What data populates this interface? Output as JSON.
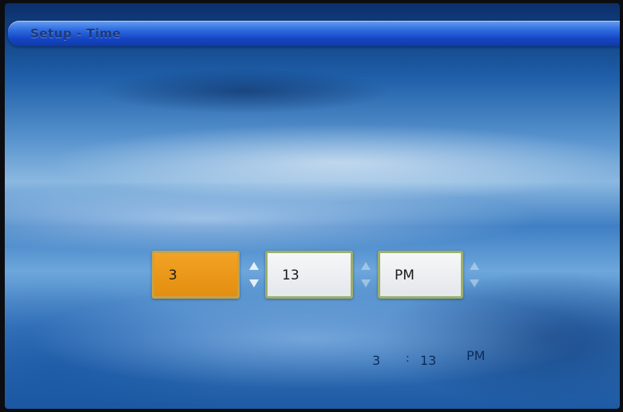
{
  "header": {
    "title": "Setup - Time"
  },
  "time_fields": {
    "hour": "3",
    "minute": "13",
    "meridiem": "PM"
  },
  "readout": {
    "hour": "3",
    "separator": ":",
    "minute": "13",
    "meridiem": "PM"
  },
  "colors": {
    "selected_field": "#e99814",
    "title_bar": "#1f55d0",
    "field_border": "#9bb06a"
  },
  "icons": {
    "spinner_up": "arrow-up-icon",
    "spinner_down": "arrow-down-icon"
  }
}
